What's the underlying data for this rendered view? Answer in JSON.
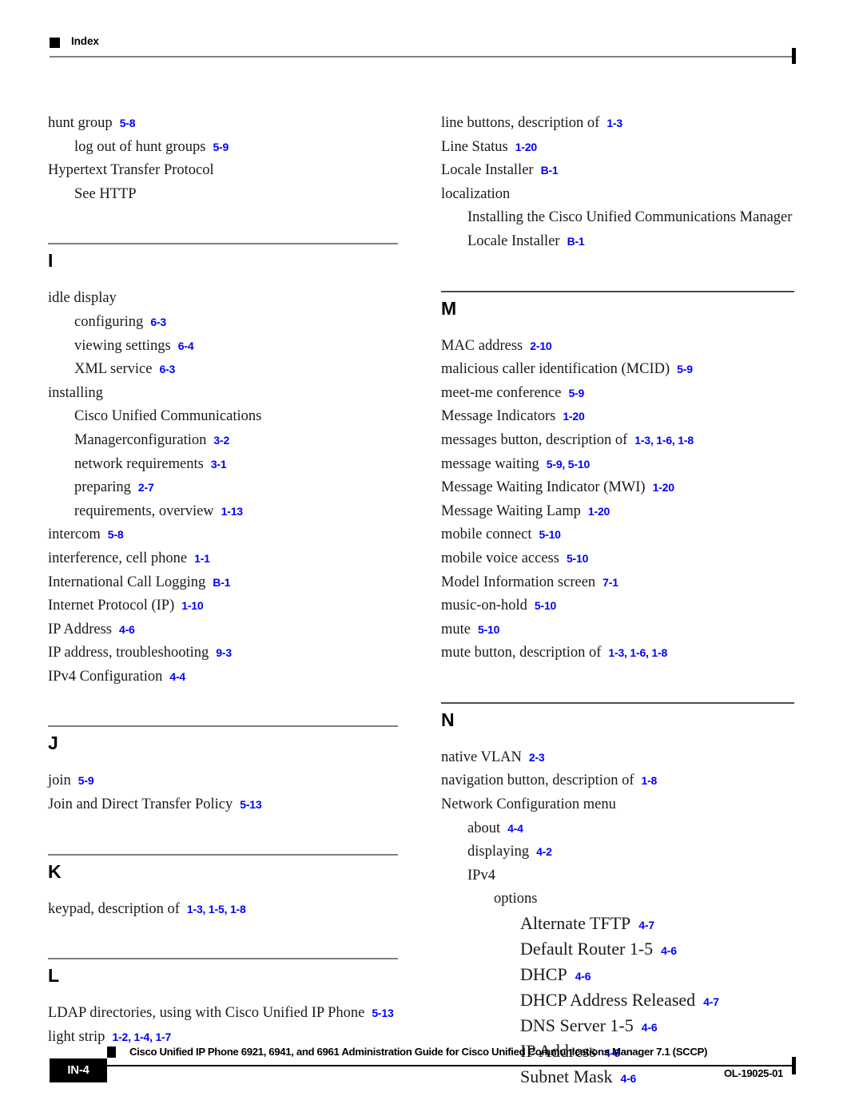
{
  "header": {
    "label": "Index",
    "bullet_icon": "black-square-icon"
  },
  "colors": {
    "page_number_blue": "#0000ff",
    "section_rule_gray": "#808080",
    "text_black": "#000000"
  },
  "columns": {
    "left": [
      {
        "type": "entries",
        "items": [
          {
            "level": 0,
            "term": "hunt group",
            "pages": "5-8"
          },
          {
            "level": 1,
            "term": "log out of hunt groups",
            "pages": "5-9"
          },
          {
            "level": 0,
            "term": "Hypertext Transfer Protocol",
            "pages": ""
          },
          {
            "level": 1,
            "term": "See HTTP",
            "pages": ""
          }
        ]
      },
      {
        "type": "section",
        "letter": "I",
        "items": [
          {
            "level": 0,
            "term": "idle display",
            "pages": ""
          },
          {
            "level": 1,
            "term": "configuring",
            "pages": "6-3"
          },
          {
            "level": 1,
            "term": "viewing settings",
            "pages": "6-4"
          },
          {
            "level": 1,
            "term": "XML service",
            "pages": "6-3"
          },
          {
            "level": 0,
            "term": "installing",
            "pages": ""
          },
          {
            "level": 1,
            "term": "Cisco Unified Communications Managerconfiguration",
            "pages": "3-2"
          },
          {
            "level": 1,
            "term": "network requirements",
            "pages": "3-1"
          },
          {
            "level": 1,
            "term": "preparing",
            "pages": "2-7"
          },
          {
            "level": 1,
            "term": "requirements, overview",
            "pages": "1-13"
          },
          {
            "level": 0,
            "term": "intercom",
            "pages": "5-8"
          },
          {
            "level": 0,
            "term": "interference, cell phone",
            "pages": "1-1"
          },
          {
            "level": 0,
            "term": "International Call Logging",
            "pages": "B-1"
          },
          {
            "level": 0,
            "term": "Internet Protocol (IP)",
            "pages": "1-10"
          },
          {
            "level": 0,
            "term": "IP Address",
            "pages": "4-6"
          },
          {
            "level": 0,
            "term": "IP address, troubleshooting",
            "pages": "9-3"
          },
          {
            "level": 0,
            "term": "IPv4 Configuration",
            "pages": "4-4"
          }
        ]
      },
      {
        "type": "section",
        "letter": "J",
        "items": [
          {
            "level": 0,
            "term": "join",
            "pages": "5-9"
          },
          {
            "level": 0,
            "term": "Join and Direct Transfer Policy",
            "pages": "5-13"
          }
        ]
      },
      {
        "type": "section",
        "letter": "K",
        "items": [
          {
            "level": 0,
            "term": "keypad, description of",
            "pages": "1-3, 1-5, 1-8"
          }
        ]
      },
      {
        "type": "section",
        "letter": "L",
        "items": [
          {
            "level": 0,
            "term": "LDAP directories, using with Cisco Unified IP Phone",
            "pages": "5-13"
          },
          {
            "level": 0,
            "term": "light strip",
            "pages": "1-2, 1-4, 1-7"
          }
        ]
      }
    ],
    "right": [
      {
        "type": "entries",
        "items": [
          {
            "level": 0,
            "term": "line buttons, description of",
            "pages": "1-3"
          },
          {
            "level": 0,
            "term": "Line Status",
            "pages": "1-20"
          },
          {
            "level": 0,
            "term": "Locale Installer",
            "pages": "B-1"
          },
          {
            "level": 0,
            "term": "localization",
            "pages": ""
          },
          {
            "level": 1,
            "term": "Installing the Cisco Unified Communications Manager Locale Installer",
            "pages": "B-1"
          }
        ]
      },
      {
        "type": "section",
        "letter": "M",
        "items": [
          {
            "level": 0,
            "term": "MAC address",
            "pages": "2-10"
          },
          {
            "level": 0,
            "term": "malicious caller identification (MCID)",
            "pages": "5-9"
          },
          {
            "level": 0,
            "term": "meet-me conference",
            "pages": "5-9"
          },
          {
            "level": 0,
            "term": "Message Indicators",
            "pages": "1-20"
          },
          {
            "level": 0,
            "term": "messages button, description of",
            "pages": "1-3, 1-6, 1-8"
          },
          {
            "level": 0,
            "term": "message waiting",
            "pages": "5-9, 5-10"
          },
          {
            "level": 0,
            "term": "Message Waiting Indicator (MWI)",
            "pages": "1-20"
          },
          {
            "level": 0,
            "term": "Message Waiting Lamp",
            "pages": "1-20"
          },
          {
            "level": 0,
            "term": "mobile connect",
            "pages": "5-10"
          },
          {
            "level": 0,
            "term": "mobile voice access",
            "pages": "5-10"
          },
          {
            "level": 0,
            "term": "Model Information screen",
            "pages": "7-1"
          },
          {
            "level": 0,
            "term": "music-on-hold",
            "pages": "5-10"
          },
          {
            "level": 0,
            "term": "mute",
            "pages": "5-10"
          },
          {
            "level": 0,
            "term": "mute button, description of",
            "pages": "1-3, 1-6, 1-8"
          }
        ]
      },
      {
        "type": "section",
        "letter": "N",
        "items": [
          {
            "level": 0,
            "term": "native VLAN",
            "pages": "2-3"
          },
          {
            "level": 0,
            "term": "navigation button, description of",
            "pages": "1-8"
          },
          {
            "level": 0,
            "term": "Network Configuration menu",
            "pages": ""
          },
          {
            "level": 1,
            "term": "about",
            "pages": "4-4"
          },
          {
            "level": 1,
            "term": "displaying",
            "pages": "4-2"
          },
          {
            "level": 1,
            "term": "IPv4",
            "pages": ""
          },
          {
            "level": 2,
            "term": "options",
            "pages": ""
          },
          {
            "level": 3,
            "term": "Alternate TFTP",
            "pages": "4-7",
            "style": "opt"
          },
          {
            "level": 3,
            "term": "Default Router 1-5",
            "pages": "4-6",
            "style": "opt"
          },
          {
            "level": 3,
            "term": "DHCP",
            "pages": "4-6",
            "style": "opt"
          },
          {
            "level": 3,
            "term": "DHCP Address Released",
            "pages": "4-7",
            "style": "opt"
          },
          {
            "level": 3,
            "term": "DNS Server 1-5",
            "pages": "4-6",
            "style": "opt"
          },
          {
            "level": 3,
            "term": "IP Address",
            "pages": "4-6",
            "style": "opt"
          },
          {
            "level": 3,
            "term": "Subnet Mask",
            "pages": "4-6",
            "style": "opt"
          }
        ]
      }
    ]
  },
  "footer": {
    "guide_title": "Cisco Unified IP Phone 6921, 6941, and 6961 Administration Guide for Cisco Unified Communications Manager 7.1 (SCCP)",
    "page_number": "IN-4",
    "document_id": "OL-19025-01",
    "bullet_icon": "black-square-icon"
  }
}
